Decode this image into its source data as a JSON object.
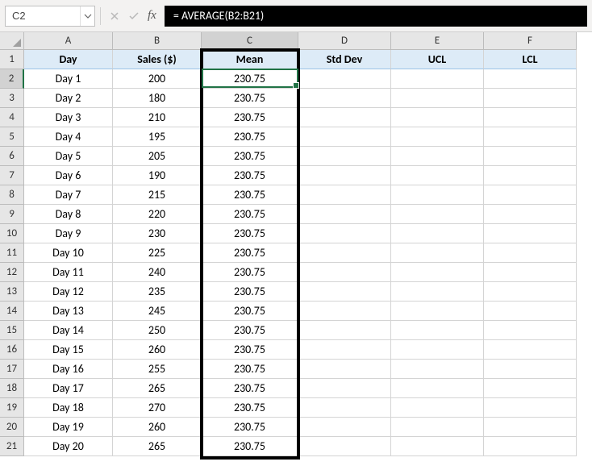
{
  "namebox": "C2",
  "formula": "= AVERAGE(B2:B21)",
  "fx_label": "fx",
  "col_headers": [
    "A",
    "B",
    "C",
    "D",
    "E",
    "F"
  ],
  "row_headers": [
    "1",
    "2",
    "3",
    "4",
    "5",
    "6",
    "7",
    "8",
    "9",
    "10",
    "11",
    "12",
    "13",
    "14",
    "15",
    "16",
    "17",
    "18",
    "19",
    "20",
    "21"
  ],
  "header_row": {
    "A": "Day",
    "B": "Sales ($)",
    "C": "Mean",
    "D": "Std Dev",
    "E": "UCL",
    "F": "LCL"
  },
  "rows": [
    {
      "A": "Day 1",
      "B": "200",
      "C": "230.75"
    },
    {
      "A": "Day 2",
      "B": "180",
      "C": "230.75"
    },
    {
      "A": "Day 3",
      "B": "210",
      "C": "230.75"
    },
    {
      "A": "Day 4",
      "B": "195",
      "C": "230.75"
    },
    {
      "A": "Day 5",
      "B": "205",
      "C": "230.75"
    },
    {
      "A": "Day 6",
      "B": "190",
      "C": "230.75"
    },
    {
      "A": "Day 7",
      "B": "215",
      "C": "230.75"
    },
    {
      "A": "Day 8",
      "B": "220",
      "C": "230.75"
    },
    {
      "A": "Day 9",
      "B": "230",
      "C": "230.75"
    },
    {
      "A": "Day 10",
      "B": "225",
      "C": "230.75"
    },
    {
      "A": "Day 11",
      "B": "240",
      "C": "230.75"
    },
    {
      "A": "Day 12",
      "B": "235",
      "C": "230.75"
    },
    {
      "A": "Day 13",
      "B": "245",
      "C": "230.75"
    },
    {
      "A": "Day 14",
      "B": "250",
      "C": "230.75"
    },
    {
      "A": "Day 15",
      "B": "260",
      "C": "230.75"
    },
    {
      "A": "Day 16",
      "B": "255",
      "C": "230.75"
    },
    {
      "A": "Day 17",
      "B": "265",
      "C": "230.75"
    },
    {
      "A": "Day 18",
      "B": "270",
      "C": "230.75"
    },
    {
      "A": "Day 19",
      "B": "260",
      "C": "230.75"
    },
    {
      "A": "Day 20",
      "B": "265",
      "C": "230.75"
    }
  ]
}
